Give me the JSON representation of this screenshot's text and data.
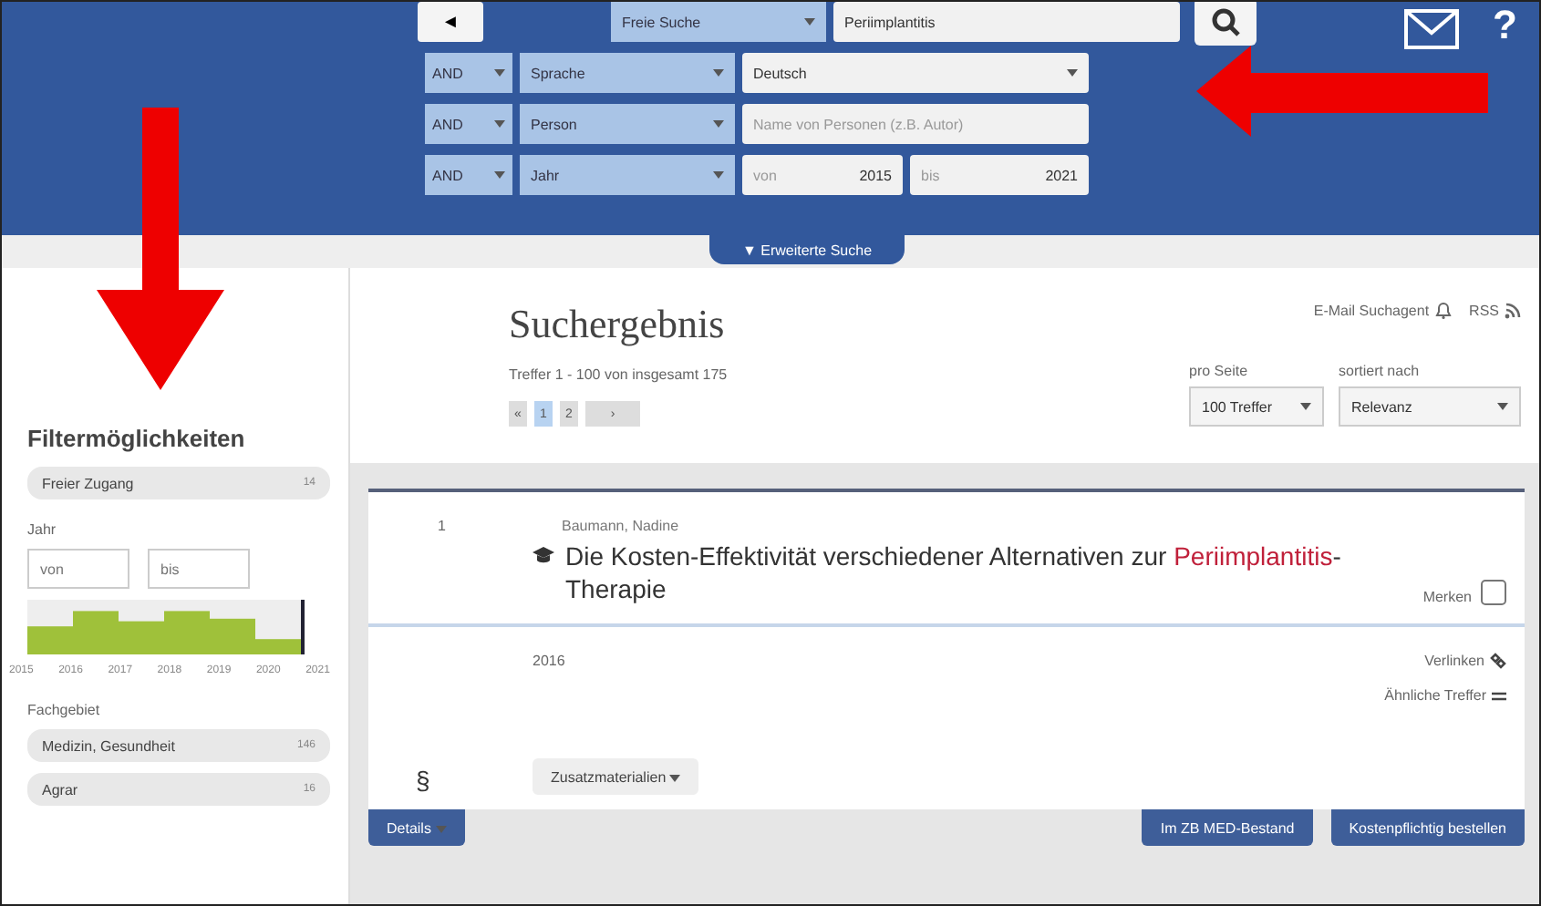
{
  "header": {
    "back_button": "◄",
    "search_rows": [
      {
        "kind": "text",
        "field": "Freie Suche",
        "value": "Periimplantitis"
      },
      {
        "kind": "select",
        "operator": "AND",
        "field": "Sprache",
        "value": "Deutsch"
      },
      {
        "kind": "text",
        "operator": "AND",
        "field": "Person",
        "placeholder": "Name von Personen (z.B. Autor)"
      },
      {
        "kind": "range",
        "operator": "AND",
        "field": "Jahr",
        "from_label": "von",
        "from": "2015",
        "to_label": "bis",
        "to": "2021"
      }
    ],
    "help": "?",
    "advanced_search": "▼ Erweiterte Suche"
  },
  "sidebar": {
    "title": "Filtermöglichkeiten",
    "facets": [
      {
        "label": "Freier Zugang",
        "count": "14"
      }
    ],
    "year": {
      "label": "Jahr",
      "from_placeholder": "von",
      "to_placeholder": "bis",
      "axis_labels": [
        "2015",
        "2016",
        "2017",
        "2018",
        "2019",
        "2020",
        "2021"
      ]
    },
    "subject": {
      "label": "Fachgebiet",
      "items": [
        {
          "label": "Medizin, Gesundheit",
          "count": "146"
        },
        {
          "label": "Agrar",
          "count": "16"
        }
      ]
    }
  },
  "results": {
    "title": "Suchergebnis",
    "alert": "E-Mail Suchagent",
    "rss": "RSS",
    "summary": "Treffer 1 - 100 von insgesamt 175",
    "pages": [
      {
        "label": "«",
        "selected": false
      },
      {
        "label": "1",
        "selected": true
      },
      {
        "label": "2",
        "selected": false
      },
      {
        "label": "›",
        "selected": false
      }
    ],
    "per_page": {
      "label": "pro Seite",
      "value": "100 Treffer"
    },
    "sort": {
      "label": "sortiert nach",
      "value": "Relevanz"
    },
    "items": [
      {
        "number": "1",
        "author": "Baumann, Nadine",
        "title": "Die Kosten-Effektivität verschiedener Alternativen zur **Periimplantitis**-Therapie",
        "bookmark_label": "Merken",
        "bookmarked": false,
        "year": "2016",
        "link": "Verlinken",
        "similar": "Ähnliche Treffer",
        "symbol": "§",
        "materials": "Zusatzmaterialien",
        "details": "Details",
        "actions": [
          "Im ZB MED-Bestand",
          "Kostenpflichtig bestellen"
        ]
      }
    ]
  }
}
